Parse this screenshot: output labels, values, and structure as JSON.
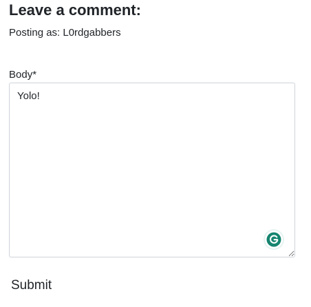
{
  "comment_form": {
    "heading": "Leave a comment:",
    "posting_as": "Posting as: L0rdgabbers",
    "body_label": "Body*",
    "body_value": "Yolo!",
    "submit_label": "Submit"
  },
  "icons": {
    "grammarly": "grammarly-icon"
  },
  "colors": {
    "grammarly_green": "#15846f",
    "text": "#212529",
    "border": "#ced4da"
  }
}
